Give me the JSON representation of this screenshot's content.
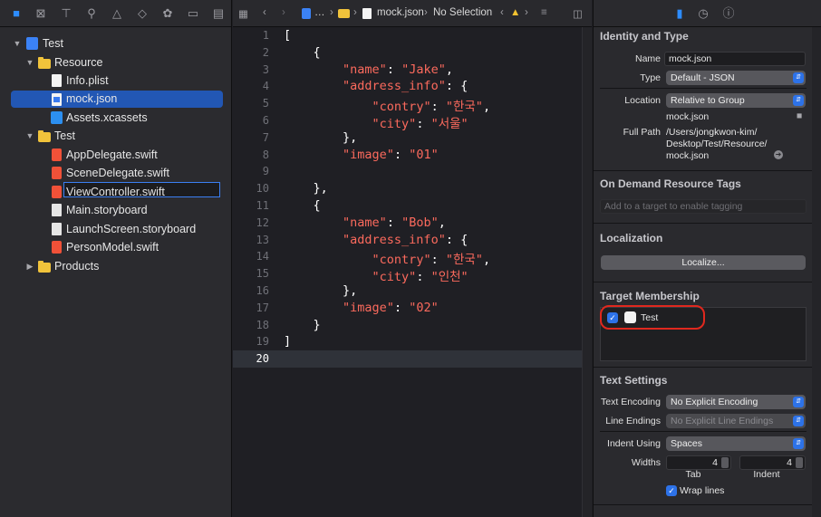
{
  "navigator": {
    "items": [
      {
        "label": "Test",
        "kind": "project"
      },
      {
        "label": "Resource",
        "kind": "folder"
      },
      {
        "label": "Info.plist",
        "kind": "doc"
      },
      {
        "label": "mock.json",
        "kind": "json"
      },
      {
        "label": "Assets.xcassets",
        "kind": "assets"
      },
      {
        "label": "Test",
        "kind": "folder"
      },
      {
        "label": "AppDelegate.swift",
        "kind": "swift"
      },
      {
        "label": "SceneDelegate.swift",
        "kind": "swift"
      },
      {
        "label": "ViewController.swift",
        "kind": "swift"
      },
      {
        "label": "Main.storyboard",
        "kind": "storyboard"
      },
      {
        "label": "LaunchScreen.storyboard",
        "kind": "storyboard"
      },
      {
        "label": "PersonModel.swift",
        "kind": "swift"
      },
      {
        "label": "Products",
        "kind": "folder"
      }
    ]
  },
  "editor": {
    "jump": {
      "ellipsis": "…",
      "file": "mock.json",
      "selection": "No Selection"
    },
    "line_numbers": [
      "1",
      "2",
      "3",
      "4",
      "5",
      "6",
      "7",
      "8",
      "9",
      "10",
      "11",
      "12",
      "13",
      "14",
      "15",
      "16",
      "17",
      "18",
      "19",
      "20"
    ],
    "current_line": "20",
    "lines": [
      "[",
      "    {",
      "        \"name\": \"Jake\",",
      "        \"address_info\": {",
      "            \"contry\": \"한국\",",
      "            \"city\": \"서울\"",
      "        },",
      "        \"image\": \"01\"",
      "",
      "    },",
      "    {",
      "        \"name\": \"Bob\",",
      "        \"address_info\": {",
      "            \"contry\": \"한국\",",
      "            \"city\": \"인천\"",
      "        },",
      "        \"image\": \"02\"",
      "    }",
      "]",
      ""
    ]
  },
  "inspector": {
    "identity": {
      "title": "Identity and Type",
      "name_label": "Name",
      "name_value": "mock.json",
      "type_label": "Type",
      "type_value": "Default - JSON",
      "location_label": "Location",
      "location_value": "Relative to Group",
      "location_file": "mock.json",
      "fullpath_label": "Full Path",
      "fullpath_value_1": "/Users/jongkwon-kim/",
      "fullpath_value_2": "Desktop/Test/Resource/",
      "fullpath_value_3": "mock.json"
    },
    "ondemand": {
      "title": "On Demand Resource Tags",
      "placeholder": "Add to a target to enable tagging"
    },
    "localization": {
      "title": "Localization",
      "button": "Localize..."
    },
    "target": {
      "title": "Target Membership",
      "target_name": "Test",
      "checked": true
    },
    "text_settings": {
      "title": "Text Settings",
      "encoding_label": "Text Encoding",
      "encoding_value": "No Explicit Encoding",
      "endings_label": "Line Endings",
      "endings_value": "No Explicit Line Endings",
      "indent_label": "Indent Using",
      "indent_value": "Spaces",
      "widths_label": "Widths",
      "tab_value": "4",
      "indent_width_value": "4",
      "tab_caption": "Tab",
      "indent_caption": "Indent",
      "wrap_label": "Wrap lines"
    }
  },
  "colors": {
    "accent": "#2d72e8",
    "highlight_ring": "#e0281e",
    "json_key": "#fc6a5d"
  }
}
